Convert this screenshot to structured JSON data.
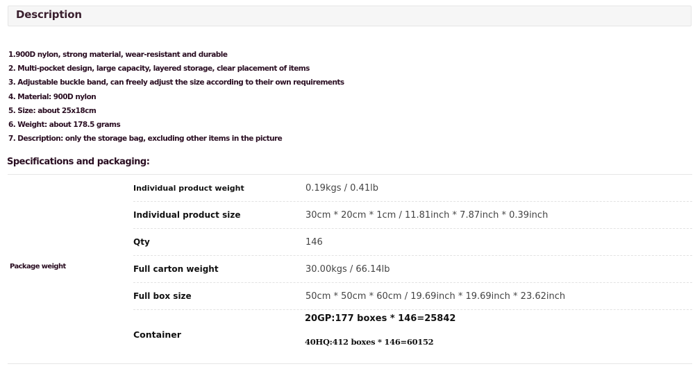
{
  "description": {
    "title": "Description",
    "features": [
      "1.900D nylon, strong material, wear-resistant and durable",
      "2. Multi-pocket design, large capacity, layered storage, clear placement of items",
      "3. Adjustable buckle band, can freely adjust the size according to their own requirements",
      "4. Material: 900D nylon",
      "5. Size: about 25x18cm",
      "6. Weight: about 178.5 grams",
      "7. Description: only the storage bag, excluding other items in the picture"
    ]
  },
  "specs": {
    "title": "Specifications and packaging:",
    "group_label": "Package weight",
    "rows": [
      {
        "label": "Individual product weight",
        "value": "0.19kgs / 0.41lb"
      },
      {
        "label": "Individual product size",
        "value": "30cm * 20cm * 1cm / 11.81inch * 7.87inch * 0.39inch"
      },
      {
        "label": "Qty",
        "value": "146"
      },
      {
        "label": "Full carton weight",
        "value": "30.00kgs / 66.14lb"
      },
      {
        "label": "Full box size",
        "value": "50cm * 50cm * 60cm / 19.69inch * 19.69inch * 23.62inch"
      }
    ],
    "container": {
      "label": "Container",
      "line1": "20GP:177 boxes * 146=25842",
      "line2": "40HQ:412 boxes * 146=60152"
    }
  }
}
